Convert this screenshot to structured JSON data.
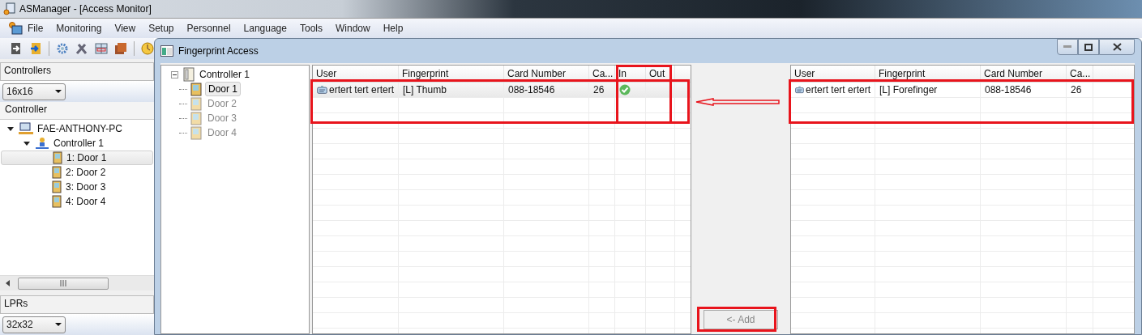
{
  "window": {
    "title": "ASManager - [Access Monitor]"
  },
  "menu": [
    "File",
    "Monitoring",
    "View",
    "Setup",
    "Personnel",
    "Language",
    "Tools",
    "Window",
    "Help"
  ],
  "controllers_panel": {
    "title": "Controllers",
    "size_select": "16x16",
    "tree_header": "Controller",
    "tree": [
      {
        "label": "FAE-ANTHONY-PC",
        "kind": "computer",
        "expanded": true,
        "children": [
          {
            "label": "Controller 1",
            "kind": "controller",
            "expanded": true,
            "children": [
              {
                "label": "1: Door 1",
                "kind": "door",
                "selected": true
              },
              {
                "label": "2: Door 2",
                "kind": "door",
                "selected": false
              },
              {
                "label": "3: Door 3",
                "kind": "door",
                "selected": false
              },
              {
                "label": "4: Door 4",
                "kind": "door",
                "selected": false
              }
            ]
          }
        ]
      }
    ]
  },
  "lprs_panel": {
    "title": "LPRs",
    "size_select": "32x32"
  },
  "child_window": {
    "title": "Fingerprint Access"
  },
  "door_tree": {
    "label": "Controller 1",
    "expanded": true,
    "children": [
      {
        "label": "Door 1",
        "selected": true
      },
      {
        "label": "Door 2",
        "selected": false
      },
      {
        "label": "Door 3",
        "selected": false
      },
      {
        "label": "Door 4",
        "selected": false
      }
    ]
  },
  "assigned_table": {
    "columns": [
      "User",
      "Fingerprint",
      "Card Number",
      "Ca...",
      "In",
      "Out"
    ],
    "rows": [
      {
        "user": "ertert tert ertert",
        "fingerprint": "[L] Thumb",
        "card_number": "088-18546",
        "column_4": "26",
        "in": true,
        "out": false
      }
    ]
  },
  "available_table": {
    "columns": [
      "User",
      "Fingerprint",
      "Card Number",
      "Ca..."
    ],
    "rows": [
      {
        "user": "ertert tert ertert",
        "fingerprint": "[L] Forefinger",
        "card_number": "088-18546",
        "column_4": "26"
      }
    ]
  },
  "add_button": {
    "label": "<- Add",
    "disabled": true
  }
}
